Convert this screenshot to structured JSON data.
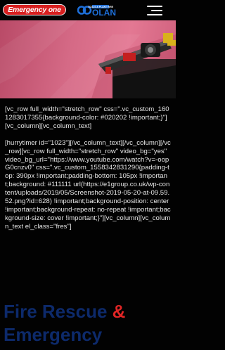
{
  "header": {
    "logo_text": "Emergency one",
    "brand_logo_text": "OLAN",
    "brand_logo_tagline": "TOOLS & PLANT HIRE",
    "menu_icon": "hamburger-menu-icon"
  },
  "hero": {
    "image": "vehicle-mounted-equipment-photo"
  },
  "content": {
    "paragraph_1": "[vc_row full_width=\"stretch_row\" css=\".vc_custom_1601283017355{background-color: #020202 !important;}\"][vc_column][vc_column_text]",
    "paragraph_2": "[hurrytimer id=\"1023\"][/vc_column_text][/vc_column][/vc_row][vc_row full_width=\"stretch_row\" video_bg=\"yes\" video_bg_url=\"https://www.youtube.com/watch?v=-oopG0cnzv0\" css=\".vc_custom_1558342831290{padding-top: 390px !important;padding-bottom: 105px !important;background: #111111 url(https://e1group.co.uk/wp-content/uploads/2019/05/Screenshot-2019-05-20-at-09.59.52.png?id=628) !important;background-position: center !important;background-repeat: no-repeat !important;background-size: cover !important;}\"][vc_column][vc_column_text el_class=\"fres\"]"
  },
  "heading": {
    "part_1": "Fire Rescue",
    "ampersand": "&",
    "part_2": "Emergency"
  },
  "colors": {
    "background": "#020202",
    "heading": "#0d2a6b",
    "accent_red": "#e02525",
    "hero_pink": "#d56a86"
  }
}
